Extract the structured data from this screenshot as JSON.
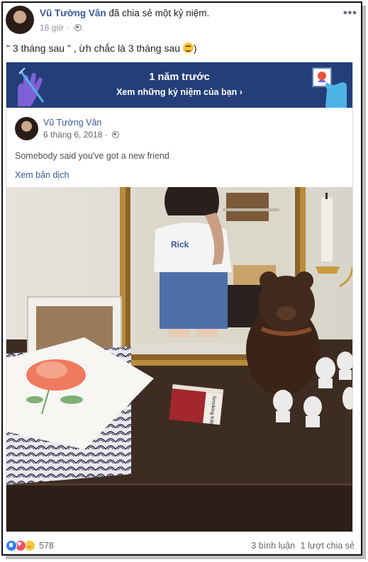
{
  "post": {
    "author": "Vũ Tường Vân",
    "action": "đã chia sẻ một kỷ niệm.",
    "time": "18 giờ",
    "text": "\" 3 tháng sau \" , ừh chắc là 3 tháng sau ",
    "text_end": ")"
  },
  "memory": {
    "title": "1 năm trước",
    "subtitle": "Xem những kỷ niệm của bạn",
    "subtitle_chevron": "›",
    "author": "Vũ Tường Vân",
    "date": "6 tháng 6, 2018",
    "text": "Somebody said you've got a new friend",
    "translate": "Xem bản dịch"
  },
  "photo": {
    "cigarette_box_text": "Smoking Kills"
  },
  "footer": {
    "reaction_count": "578",
    "comments": "3 bình luận",
    "shares": "1 lượt chia sẻ"
  },
  "icons": {
    "more": "more-options-icon",
    "privacy": "globe-icon",
    "like": "like-reaction-icon",
    "love": "love-reaction-icon",
    "sad": "sad-reaction-icon"
  },
  "colors": {
    "link": "#385898",
    "banner": "#233e78",
    "meta": "#90949c",
    "like": "#2f7ef0",
    "love": "#f25268",
    "sad": "#f7c63b"
  }
}
